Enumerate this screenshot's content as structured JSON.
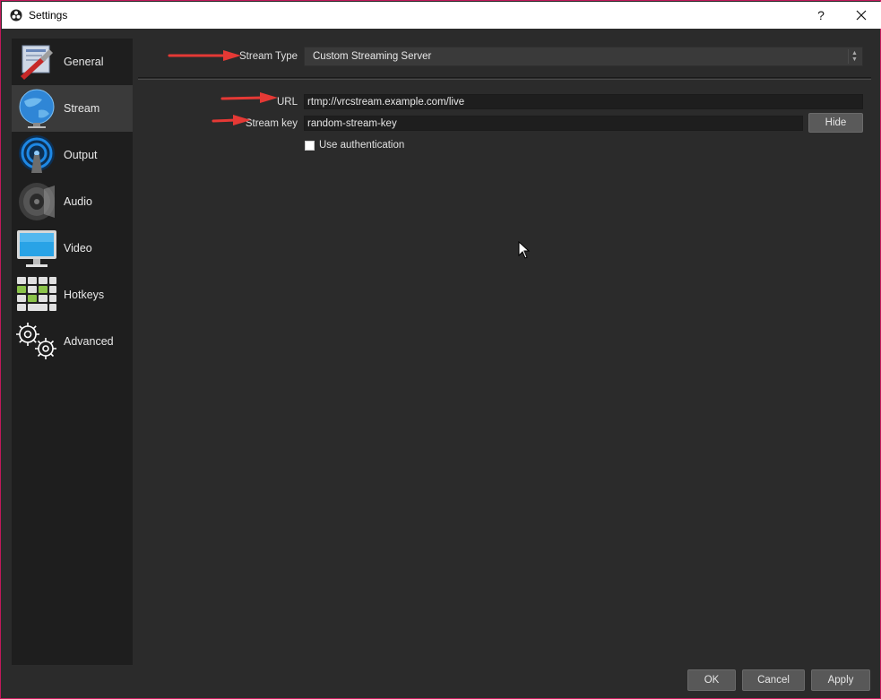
{
  "window": {
    "title": "Settings",
    "help_label": "?",
    "close_label": "✕"
  },
  "sidebar": {
    "items": [
      {
        "label": "General",
        "icon": "general-icon"
      },
      {
        "label": "Stream",
        "icon": "stream-globe-icon",
        "active": true
      },
      {
        "label": "Output",
        "icon": "output-antenna-icon"
      },
      {
        "label": "Audio",
        "icon": "speaker-icon"
      },
      {
        "label": "Video",
        "icon": "monitor-icon"
      },
      {
        "label": "Hotkeys",
        "icon": "keyboard-icon"
      },
      {
        "label": "Advanced",
        "icon": "gears-icon"
      }
    ]
  },
  "stream": {
    "stream_type_label": "Stream Type",
    "stream_type_value": "Custom Streaming Server",
    "url_label": "URL",
    "url_value": "rtmp://vrcstream.example.com/live",
    "stream_key_label": "Stream key",
    "stream_key_value": "random-stream-key",
    "hide_label": "Hide",
    "use_auth_label": "Use authentication",
    "use_auth_checked": false
  },
  "footer": {
    "ok_label": "OK",
    "cancel_label": "Cancel",
    "apply_label": "Apply"
  },
  "colors": {
    "annotation_arrow": "#e53935",
    "window_border": "#c2185b",
    "background": "#2b2b2b",
    "sidebar": "#1e1e1e"
  }
}
